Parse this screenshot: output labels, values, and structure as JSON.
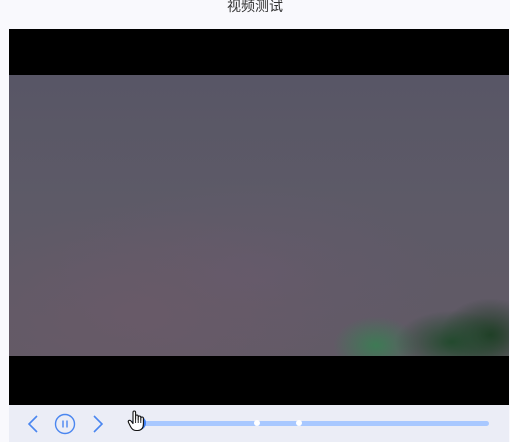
{
  "title": "视频测试",
  "player": {
    "progress_percent": 0.5,
    "markers_percent": [
      34,
      46
    ],
    "colors": {
      "accent": "#3e7ff5",
      "track": "#a8c8ff",
      "controls_bg": "#ebedf6",
      "icon": "#4a86f0"
    }
  },
  "controls": {
    "prev_icon": "chevron-left-icon",
    "play_icon": "pause-circle-icon",
    "next_icon": "chevron-right-icon"
  }
}
